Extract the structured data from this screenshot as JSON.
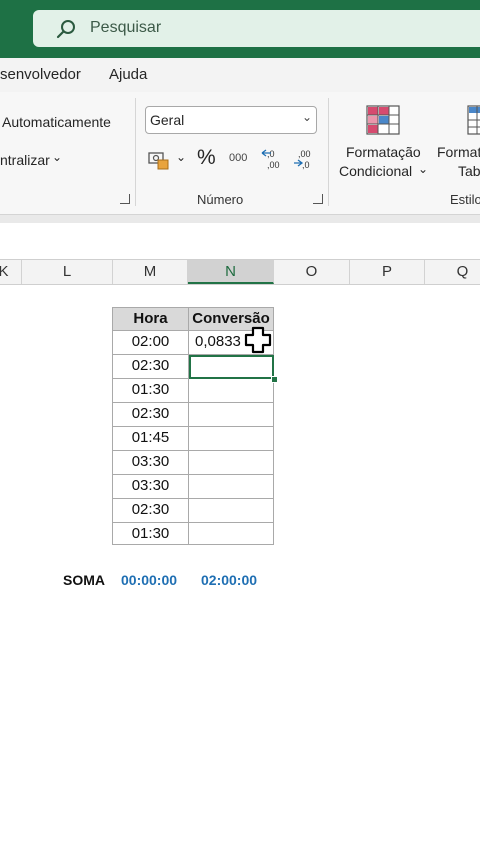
{
  "search": {
    "placeholder": "Pesquisar"
  },
  "menu": {
    "tabs": [
      "senvolvedor",
      "Ajuda"
    ]
  },
  "ribbon": {
    "alignment": {
      "wrap_label": "Automaticamente",
      "center_label": "ntralizar"
    },
    "number": {
      "format_value": "Geral",
      "percent": "%",
      "thousands": "000",
      "group_label": "Número"
    },
    "styles": {
      "conditional_line1": "Formatação",
      "conditional_line2": "Condicional",
      "table_line1": "Formatar",
      "table_line2": "Tabela",
      "group_label": "Estilos"
    }
  },
  "columns": [
    "K",
    "L",
    "M",
    "N",
    "O",
    "P",
    "Q"
  ],
  "table": {
    "header_hora": "Hora",
    "header_conversao": "Conversão",
    "horas": [
      "02:00",
      "02:30",
      "01:30",
      "02:30",
      "01:45",
      "03:30",
      "03:30",
      "02:30",
      "01:30"
    ],
    "conversoes": [
      "0,0833",
      "",
      "",
      "",
      "",
      "",
      "",
      "",
      ""
    ]
  },
  "soma": {
    "label": "SOMA",
    "value1": "00:00:00",
    "value2": "02:00:00"
  },
  "colors": {
    "excel_green": "#1e7145",
    "accent_blue": "#1f6fb3"
  }
}
